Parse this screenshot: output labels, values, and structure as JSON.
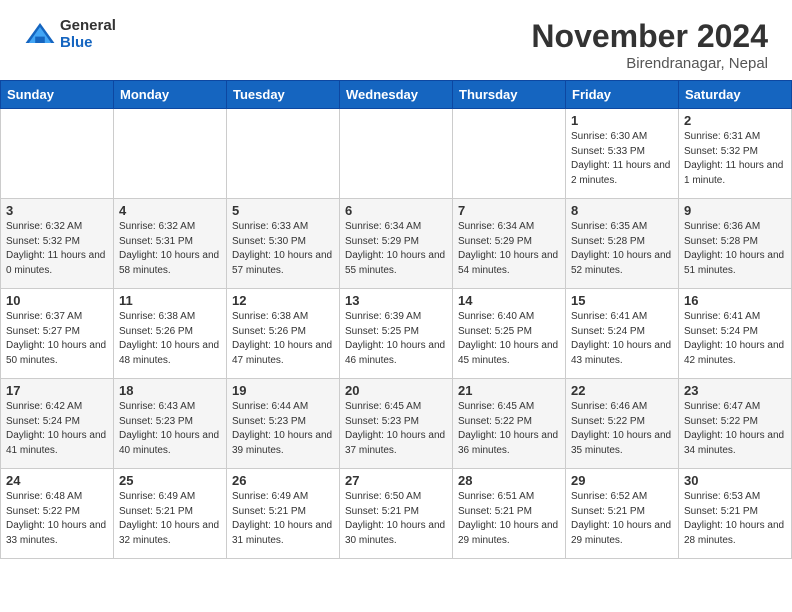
{
  "header": {
    "logo_general": "General",
    "logo_blue": "Blue",
    "month_title": "November 2024",
    "location": "Birendranagar, Nepal"
  },
  "days_of_week": [
    "Sunday",
    "Monday",
    "Tuesday",
    "Wednesday",
    "Thursday",
    "Friday",
    "Saturday"
  ],
  "weeks": [
    [
      {
        "day": "",
        "info": ""
      },
      {
        "day": "",
        "info": ""
      },
      {
        "day": "",
        "info": ""
      },
      {
        "day": "",
        "info": ""
      },
      {
        "day": "",
        "info": ""
      },
      {
        "day": "1",
        "info": "Sunrise: 6:30 AM\nSunset: 5:33 PM\nDaylight: 11 hours and 2 minutes."
      },
      {
        "day": "2",
        "info": "Sunrise: 6:31 AM\nSunset: 5:32 PM\nDaylight: 11 hours and 1 minute."
      }
    ],
    [
      {
        "day": "3",
        "info": "Sunrise: 6:32 AM\nSunset: 5:32 PM\nDaylight: 11 hours and 0 minutes."
      },
      {
        "day": "4",
        "info": "Sunrise: 6:32 AM\nSunset: 5:31 PM\nDaylight: 10 hours and 58 minutes."
      },
      {
        "day": "5",
        "info": "Sunrise: 6:33 AM\nSunset: 5:30 PM\nDaylight: 10 hours and 57 minutes."
      },
      {
        "day": "6",
        "info": "Sunrise: 6:34 AM\nSunset: 5:29 PM\nDaylight: 10 hours and 55 minutes."
      },
      {
        "day": "7",
        "info": "Sunrise: 6:34 AM\nSunset: 5:29 PM\nDaylight: 10 hours and 54 minutes."
      },
      {
        "day": "8",
        "info": "Sunrise: 6:35 AM\nSunset: 5:28 PM\nDaylight: 10 hours and 52 minutes."
      },
      {
        "day": "9",
        "info": "Sunrise: 6:36 AM\nSunset: 5:28 PM\nDaylight: 10 hours and 51 minutes."
      }
    ],
    [
      {
        "day": "10",
        "info": "Sunrise: 6:37 AM\nSunset: 5:27 PM\nDaylight: 10 hours and 50 minutes."
      },
      {
        "day": "11",
        "info": "Sunrise: 6:38 AM\nSunset: 5:26 PM\nDaylight: 10 hours and 48 minutes."
      },
      {
        "day": "12",
        "info": "Sunrise: 6:38 AM\nSunset: 5:26 PM\nDaylight: 10 hours and 47 minutes."
      },
      {
        "day": "13",
        "info": "Sunrise: 6:39 AM\nSunset: 5:25 PM\nDaylight: 10 hours and 46 minutes."
      },
      {
        "day": "14",
        "info": "Sunrise: 6:40 AM\nSunset: 5:25 PM\nDaylight: 10 hours and 45 minutes."
      },
      {
        "day": "15",
        "info": "Sunrise: 6:41 AM\nSunset: 5:24 PM\nDaylight: 10 hours and 43 minutes."
      },
      {
        "day": "16",
        "info": "Sunrise: 6:41 AM\nSunset: 5:24 PM\nDaylight: 10 hours and 42 minutes."
      }
    ],
    [
      {
        "day": "17",
        "info": "Sunrise: 6:42 AM\nSunset: 5:24 PM\nDaylight: 10 hours and 41 minutes."
      },
      {
        "day": "18",
        "info": "Sunrise: 6:43 AM\nSunset: 5:23 PM\nDaylight: 10 hours and 40 minutes."
      },
      {
        "day": "19",
        "info": "Sunrise: 6:44 AM\nSunset: 5:23 PM\nDaylight: 10 hours and 39 minutes."
      },
      {
        "day": "20",
        "info": "Sunrise: 6:45 AM\nSunset: 5:23 PM\nDaylight: 10 hours and 37 minutes."
      },
      {
        "day": "21",
        "info": "Sunrise: 6:45 AM\nSunset: 5:22 PM\nDaylight: 10 hours and 36 minutes."
      },
      {
        "day": "22",
        "info": "Sunrise: 6:46 AM\nSunset: 5:22 PM\nDaylight: 10 hours and 35 minutes."
      },
      {
        "day": "23",
        "info": "Sunrise: 6:47 AM\nSunset: 5:22 PM\nDaylight: 10 hours and 34 minutes."
      }
    ],
    [
      {
        "day": "24",
        "info": "Sunrise: 6:48 AM\nSunset: 5:22 PM\nDaylight: 10 hours and 33 minutes."
      },
      {
        "day": "25",
        "info": "Sunrise: 6:49 AM\nSunset: 5:21 PM\nDaylight: 10 hours and 32 minutes."
      },
      {
        "day": "26",
        "info": "Sunrise: 6:49 AM\nSunset: 5:21 PM\nDaylight: 10 hours and 31 minutes."
      },
      {
        "day": "27",
        "info": "Sunrise: 6:50 AM\nSunset: 5:21 PM\nDaylight: 10 hours and 30 minutes."
      },
      {
        "day": "28",
        "info": "Sunrise: 6:51 AM\nSunset: 5:21 PM\nDaylight: 10 hours and 29 minutes."
      },
      {
        "day": "29",
        "info": "Sunrise: 6:52 AM\nSunset: 5:21 PM\nDaylight: 10 hours and 29 minutes."
      },
      {
        "day": "30",
        "info": "Sunrise: 6:53 AM\nSunset: 5:21 PM\nDaylight: 10 hours and 28 minutes."
      }
    ]
  ]
}
